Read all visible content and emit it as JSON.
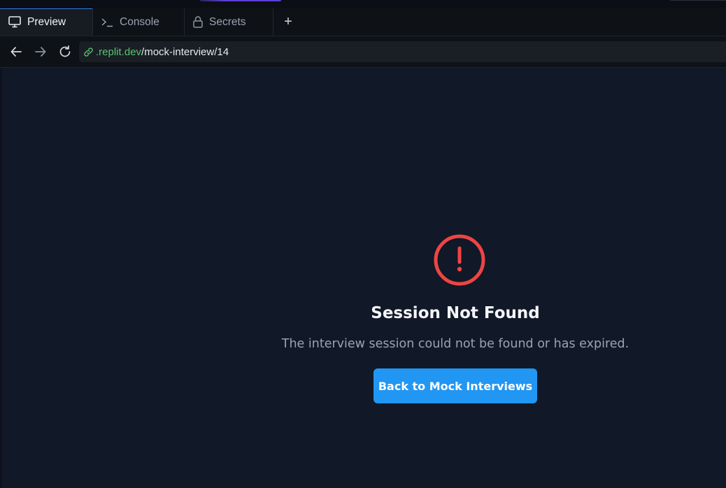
{
  "tabs": [
    {
      "label": "Preview",
      "icon": "monitor-icon",
      "active": true
    },
    {
      "label": "Console",
      "icon": "terminal-icon",
      "active": false
    },
    {
      "label": "Secrets",
      "icon": "lock-icon",
      "active": false
    }
  ],
  "add_tab_label": "+",
  "address": {
    "host": ".replit.dev",
    "path": "/mock-interview/14"
  },
  "error": {
    "icon": "alert-circle-icon",
    "title": "Session Not Found",
    "message": "The interview session could not be found or has expired.",
    "button_label": "Back to Mock Interviews"
  },
  "colors": {
    "background": "#111827",
    "alert": "#ef4444",
    "button": "#2196f3",
    "url_host": "#57c46e"
  }
}
